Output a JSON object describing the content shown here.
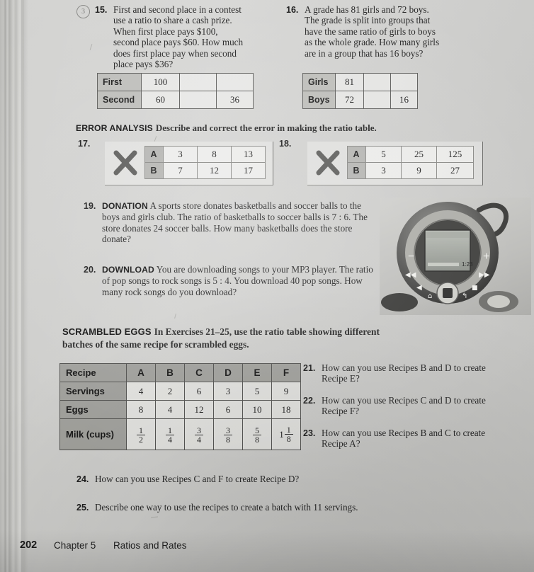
{
  "page": {
    "number": "202",
    "chapter": "Chapter 5",
    "title": "Ratios and Rates",
    "compass_icon": "3"
  },
  "exercises": {
    "q15": {
      "number": "15.",
      "text": "First and second place in a contest use a ratio to share a cash prize. When first place pays $100, second place pays $60. How much does first place pay when second place pays $36?",
      "table": {
        "rows": [
          {
            "label": "First",
            "cells": [
              "100",
              "",
              ""
            ]
          },
          {
            "label": "Second",
            "cells": [
              "60",
              "",
              "36"
            ]
          }
        ]
      }
    },
    "q16": {
      "number": "16.",
      "text": "A grade has 81 girls and 72 boys. The grade is split into groups that have the same ratio of girls to boys as the whole grade. How many girls are in a group that has 16 boys?",
      "table": {
        "rows": [
          {
            "label": "Girls",
            "cells": [
              "81",
              "",
              ""
            ]
          },
          {
            "label": "Boys",
            "cells": [
              "72",
              "",
              "16"
            ]
          }
        ]
      }
    },
    "error_analysis": {
      "heading_label": "ERROR ANALYSIS",
      "heading_text": "Describe and correct the error in making the ratio table.",
      "q17": {
        "number": "17.",
        "icon": "x-mark-icon",
        "table": {
          "rows": [
            {
              "label": "A",
              "cells": [
                "3",
                "8",
                "13"
              ]
            },
            {
              "label": "B",
              "cells": [
                "7",
                "12",
                "17"
              ]
            }
          ]
        }
      },
      "q18": {
        "number": "18.",
        "icon": "x-mark-icon",
        "table": {
          "rows": [
            {
              "label": "A",
              "cells": [
                "5",
                "25",
                "125"
              ]
            },
            {
              "label": "B",
              "cells": [
                "3",
                "9",
                "27"
              ]
            }
          ]
        }
      }
    },
    "q19": {
      "number": "19.",
      "label": "DONATION",
      "text": "A sports store donates basketballs and soccer balls to the boys and girls club. The ratio of basketballs to soccer balls is 7 : 6. The store donates 24 soccer balls. How many basketballs does the store donate?"
    },
    "q20": {
      "number": "20.",
      "label": "DOWNLOAD",
      "text": "You are downloading songs to your MP3 player. The ratio of pop songs to rock songs is 5 : 4. You download 40 pop songs. How many rock songs do you download?"
    },
    "scrambled_eggs": {
      "heading_label": "SCRAMBLED EGGS",
      "heading_text": "In Exercises 21–25, use the ratio table showing different batches of the same recipe for scrambled eggs.",
      "q21": {
        "number": "21.",
        "text": "How can you use Recipes B and D to create Recipe E?"
      },
      "q22": {
        "number": "22.",
        "text": "How can you use Recipes C and D to create Recipe F?"
      },
      "q23": {
        "number": "23.",
        "text": "How can you use Recipes B and C to create Recipe A?"
      },
      "q24": {
        "number": "24.",
        "text": "How can you use Recipes C and F to create Recipe D?"
      },
      "q25": {
        "number": "25.",
        "text": "Describe one way to use the recipes to create a batch with 11 servings."
      }
    }
  },
  "recipe_table": {
    "corner_label": "Recipe",
    "recipes": [
      "A",
      "B",
      "C",
      "D",
      "E",
      "F"
    ],
    "rows": [
      {
        "label": "Servings",
        "values": [
          "4",
          "2",
          "6",
          "3",
          "5",
          "9"
        ]
      },
      {
        "label": "Eggs",
        "values": [
          "8",
          "4",
          "12",
          "6",
          "10",
          "18"
        ]
      },
      {
        "label": "Milk (cups)",
        "values": [
          "1/2",
          "1/4",
          "3/4",
          "3/8",
          "5/8",
          "1 1/8"
        ],
        "fractions": [
          {
            "whole": "",
            "num": "1",
            "den": "2"
          },
          {
            "whole": "",
            "num": "1",
            "den": "4"
          },
          {
            "whole": "",
            "num": "3",
            "den": "4"
          },
          {
            "whole": "",
            "num": "3",
            "den": "8"
          },
          {
            "whole": "",
            "num": "5",
            "den": "8"
          },
          {
            "whole": "1",
            "num": "1",
            "den": "8"
          }
        ]
      }
    ]
  },
  "mp3_player": {
    "icon": "mp3-player-photo",
    "screen_time": "1:23",
    "buttons": [
      "minus",
      "plus",
      "rewind",
      "fast-forward",
      "play",
      "stop",
      "home",
      "back",
      "select"
    ]
  },
  "colors": {
    "paper": "#cfcfcd",
    "ink": "#1e1e1e",
    "table_header_fill": "#96968f",
    "rule": "#4f4f4d"
  }
}
